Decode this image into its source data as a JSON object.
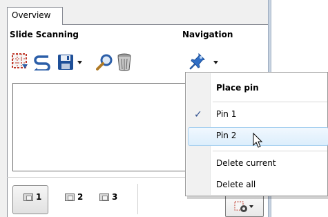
{
  "tabs": [
    {
      "label": "Overview"
    }
  ],
  "slide_scanning": {
    "title": "Slide Scanning",
    "tools": [
      {
        "icon": "scan-area-icon"
      },
      {
        "icon": "rotate-icon"
      },
      {
        "icon": "save-icon"
      },
      {
        "icon": "dropdown-arrow-icon"
      },
      {
        "icon": "magnifier-icon"
      },
      {
        "icon": "trash-icon"
      }
    ]
  },
  "navigation": {
    "title": "Navigation",
    "tools": [
      {
        "icon": "pin-icon"
      },
      {
        "icon": "dropdown-arrow-icon"
      }
    ]
  },
  "slots": [
    {
      "label": "1",
      "icon": "slide-icon"
    },
    {
      "label": "2",
      "icon": "slide-icon"
    },
    {
      "label": "3",
      "icon": "slide-icon"
    }
  ],
  "context_menu": {
    "header": "Place pin",
    "items": [
      {
        "label": "Pin 1",
        "checked": true
      },
      {
        "label": "Pin 2",
        "checked": false,
        "hovered": true
      }
    ],
    "actions": [
      {
        "label": "Delete current"
      },
      {
        "label": "Delete all"
      }
    ],
    "check_mark": "✓"
  },
  "colors": {
    "accent_blue": "#2b5ea8",
    "menu_hover": "#dceefc",
    "save_blue": "#1e4f98",
    "pin_blue": "#2f6ec6"
  }
}
